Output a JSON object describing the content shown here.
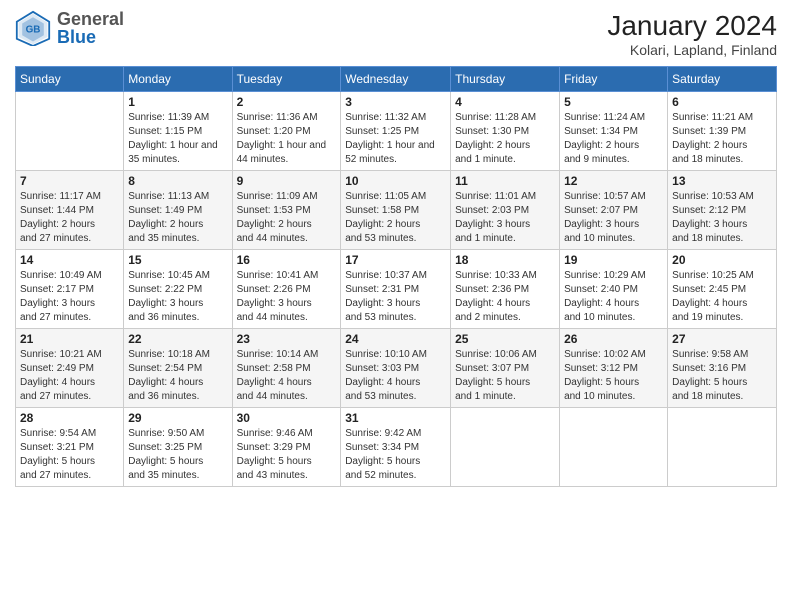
{
  "header": {
    "logo_line1": "General",
    "logo_line2": "Blue",
    "title": "January 2024",
    "subtitle": "Kolari, Lapland, Finland"
  },
  "calendar": {
    "days_of_week": [
      "Sunday",
      "Monday",
      "Tuesday",
      "Wednesday",
      "Thursday",
      "Friday",
      "Saturday"
    ],
    "weeks": [
      [
        {
          "day": "",
          "info": ""
        },
        {
          "day": "1",
          "info": "Sunrise: 11:39 AM\nSunset: 1:15 PM\nDaylight: 1 hour and\n35 minutes."
        },
        {
          "day": "2",
          "info": "Sunrise: 11:36 AM\nSunset: 1:20 PM\nDaylight: 1 hour and\n44 minutes."
        },
        {
          "day": "3",
          "info": "Sunrise: 11:32 AM\nSunset: 1:25 PM\nDaylight: 1 hour and\n52 minutes."
        },
        {
          "day": "4",
          "info": "Sunrise: 11:28 AM\nSunset: 1:30 PM\nDaylight: 2 hours\nand 1 minute."
        },
        {
          "day": "5",
          "info": "Sunrise: 11:24 AM\nSunset: 1:34 PM\nDaylight: 2 hours\nand 9 minutes."
        },
        {
          "day": "6",
          "info": "Sunrise: 11:21 AM\nSunset: 1:39 PM\nDaylight: 2 hours\nand 18 minutes."
        }
      ],
      [
        {
          "day": "7",
          "info": "Sunrise: 11:17 AM\nSunset: 1:44 PM\nDaylight: 2 hours\nand 27 minutes."
        },
        {
          "day": "8",
          "info": "Sunrise: 11:13 AM\nSunset: 1:49 PM\nDaylight: 2 hours\nand 35 minutes."
        },
        {
          "day": "9",
          "info": "Sunrise: 11:09 AM\nSunset: 1:53 PM\nDaylight: 2 hours\nand 44 minutes."
        },
        {
          "day": "10",
          "info": "Sunrise: 11:05 AM\nSunset: 1:58 PM\nDaylight: 2 hours\nand 53 minutes."
        },
        {
          "day": "11",
          "info": "Sunrise: 11:01 AM\nSunset: 2:03 PM\nDaylight: 3 hours\nand 1 minute."
        },
        {
          "day": "12",
          "info": "Sunrise: 10:57 AM\nSunset: 2:07 PM\nDaylight: 3 hours\nand 10 minutes."
        },
        {
          "day": "13",
          "info": "Sunrise: 10:53 AM\nSunset: 2:12 PM\nDaylight: 3 hours\nand 18 minutes."
        }
      ],
      [
        {
          "day": "14",
          "info": "Sunrise: 10:49 AM\nSunset: 2:17 PM\nDaylight: 3 hours\nand 27 minutes."
        },
        {
          "day": "15",
          "info": "Sunrise: 10:45 AM\nSunset: 2:22 PM\nDaylight: 3 hours\nand 36 minutes."
        },
        {
          "day": "16",
          "info": "Sunrise: 10:41 AM\nSunset: 2:26 PM\nDaylight: 3 hours\nand 44 minutes."
        },
        {
          "day": "17",
          "info": "Sunrise: 10:37 AM\nSunset: 2:31 PM\nDaylight: 3 hours\nand 53 minutes."
        },
        {
          "day": "18",
          "info": "Sunrise: 10:33 AM\nSunset: 2:36 PM\nDaylight: 4 hours\nand 2 minutes."
        },
        {
          "day": "19",
          "info": "Sunrise: 10:29 AM\nSunset: 2:40 PM\nDaylight: 4 hours\nand 10 minutes."
        },
        {
          "day": "20",
          "info": "Sunrise: 10:25 AM\nSunset: 2:45 PM\nDaylight: 4 hours\nand 19 minutes."
        }
      ],
      [
        {
          "day": "21",
          "info": "Sunrise: 10:21 AM\nSunset: 2:49 PM\nDaylight: 4 hours\nand 27 minutes."
        },
        {
          "day": "22",
          "info": "Sunrise: 10:18 AM\nSunset: 2:54 PM\nDaylight: 4 hours\nand 36 minutes."
        },
        {
          "day": "23",
          "info": "Sunrise: 10:14 AM\nSunset: 2:58 PM\nDaylight: 4 hours\nand 44 minutes."
        },
        {
          "day": "24",
          "info": "Sunrise: 10:10 AM\nSunset: 3:03 PM\nDaylight: 4 hours\nand 53 minutes."
        },
        {
          "day": "25",
          "info": "Sunrise: 10:06 AM\nSunset: 3:07 PM\nDaylight: 5 hours\nand 1 minute."
        },
        {
          "day": "26",
          "info": "Sunrise: 10:02 AM\nSunset: 3:12 PM\nDaylight: 5 hours\nand 10 minutes."
        },
        {
          "day": "27",
          "info": "Sunrise: 9:58 AM\nSunset: 3:16 PM\nDaylight: 5 hours\nand 18 minutes."
        }
      ],
      [
        {
          "day": "28",
          "info": "Sunrise: 9:54 AM\nSunset: 3:21 PM\nDaylight: 5 hours\nand 27 minutes."
        },
        {
          "day": "29",
          "info": "Sunrise: 9:50 AM\nSunset: 3:25 PM\nDaylight: 5 hours\nand 35 minutes."
        },
        {
          "day": "30",
          "info": "Sunrise: 9:46 AM\nSunset: 3:29 PM\nDaylight: 5 hours\nand 43 minutes."
        },
        {
          "day": "31",
          "info": "Sunrise: 9:42 AM\nSunset: 3:34 PM\nDaylight: 5 hours\nand 52 minutes."
        },
        {
          "day": "",
          "info": ""
        },
        {
          "day": "",
          "info": ""
        },
        {
          "day": "",
          "info": ""
        }
      ]
    ]
  }
}
